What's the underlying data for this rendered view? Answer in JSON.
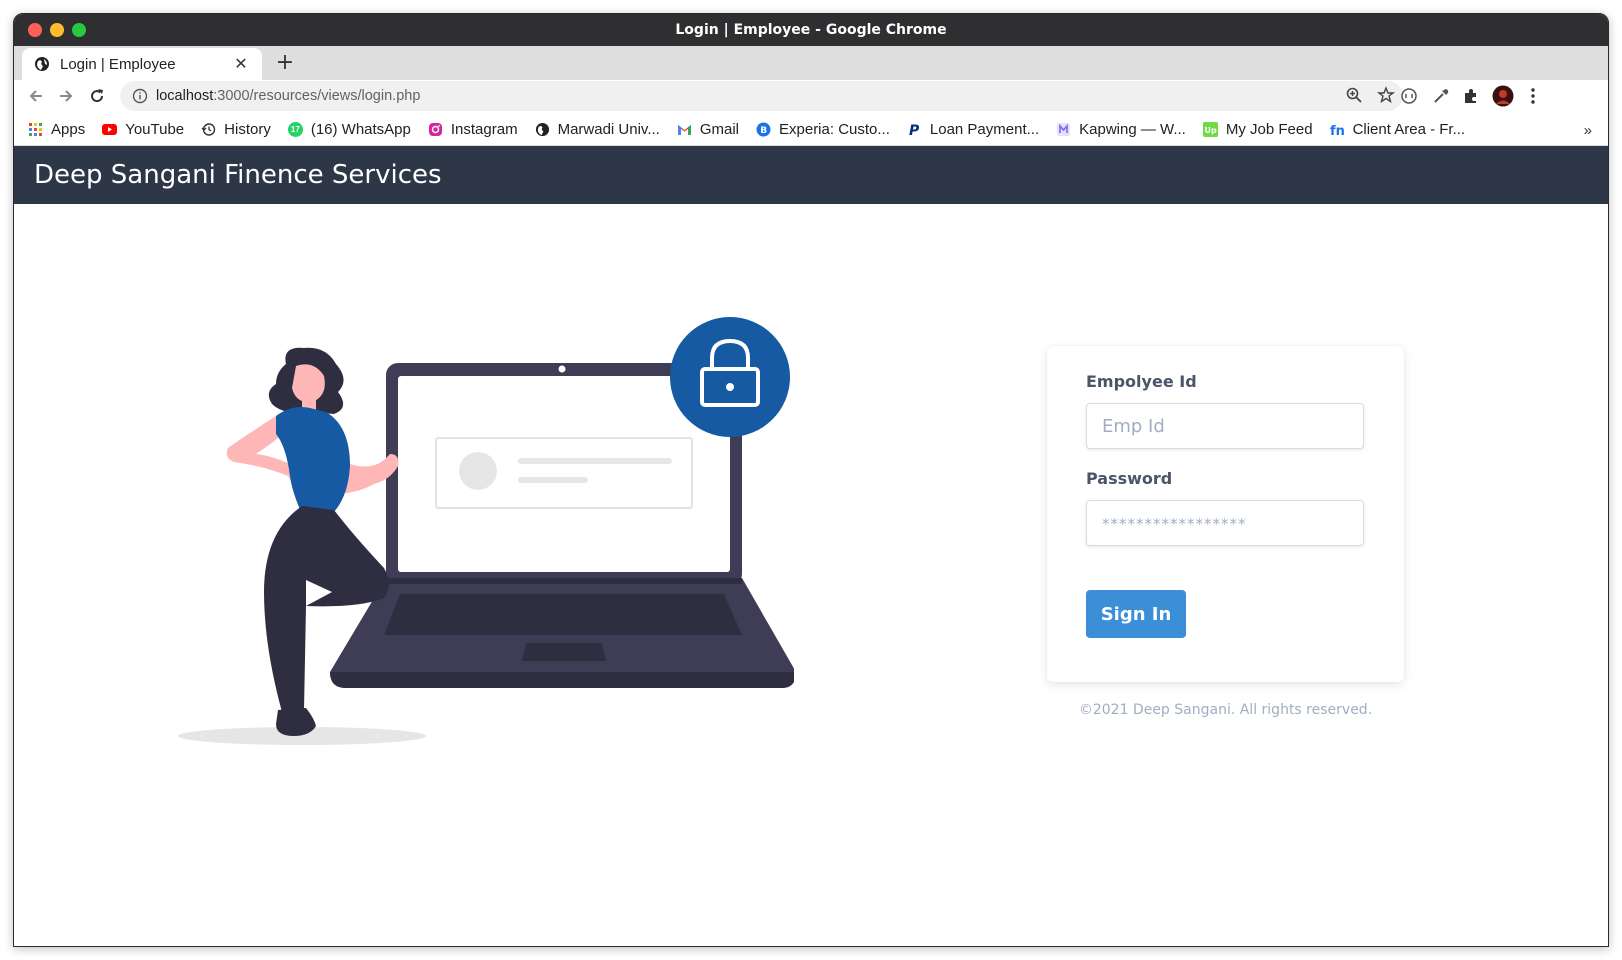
{
  "window": {
    "title": "Login | Employee - Google Chrome"
  },
  "tab": {
    "title": "Login | Employee",
    "close": "✕",
    "new_tab": "+"
  },
  "address_bar": {
    "host": "localhost",
    "path": ":3000/resources/views/login.php"
  },
  "bookmarks": [
    {
      "label": "Apps",
      "icon": "apps-grid-icon",
      "color": "#4285f4"
    },
    {
      "label": "YouTube",
      "icon": "youtube-icon",
      "color": "#ff0000"
    },
    {
      "label": "History",
      "icon": "history-icon",
      "color": "#333333"
    },
    {
      "label": "(16) WhatsApp",
      "icon": "whatsapp-icon",
      "color": "#25d366",
      "badge": "17"
    },
    {
      "label": "Instagram",
      "icon": "instagram-icon",
      "color": "#d6249f"
    },
    {
      "label": "Marwadi Univ...",
      "icon": "globe-icon",
      "color": "#333333"
    },
    {
      "label": "Gmail",
      "icon": "gmail-icon",
      "color": "#ea4335"
    },
    {
      "label": "Experia: Custo...",
      "icon": "experia-icon",
      "color": "#1a73e8"
    },
    {
      "label": "Loan Payment...",
      "icon": "paypal-icon",
      "color": "#003087"
    },
    {
      "label": "Kapwing — W...",
      "icon": "kapwing-icon",
      "color": "#7b68ee"
    },
    {
      "label": "My Job Feed",
      "icon": "upwork-icon",
      "color": "#6fda44"
    },
    {
      "label": "Client Area - Fr...",
      "icon": "fn-icon",
      "color": "#1a73e8"
    }
  ],
  "bookmarks_more": "»",
  "site": {
    "brand": "Deep Sangani Finence Services",
    "nav_color": "#2d3748"
  },
  "login": {
    "emp_label": "Empolyee Id",
    "emp_placeholder": "Emp Id",
    "password_label": "Password",
    "password_placeholder": "*****************",
    "sign_in": "Sign In",
    "button_color": "#3a8fd6"
  },
  "footer": {
    "copyright": "©2021 Deep Sangani. All rights reserved."
  },
  "illustration": {
    "lock_color": "#155aa2",
    "laptop_color": "#3f3d56",
    "shirt_color": "#155aa2",
    "skin_color": "#ffb6b6"
  }
}
